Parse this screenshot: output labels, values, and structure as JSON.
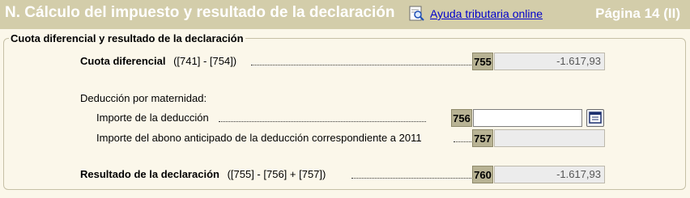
{
  "header": {
    "title": "N. Cálculo del impuesto y resultado de la declaración",
    "help_icon": "help-magnifier-icon",
    "help_link": "Ayuda tributaria online",
    "page": "Página 14 (II)"
  },
  "section": {
    "title": "Cuota diferencial y resultado de la declaración",
    "cuota": {
      "label": "Cuota diferencial",
      "formula": "([741] - [754])",
      "code": "755",
      "value": "-1.617,93"
    },
    "maternidad_heading": "Deducción por maternidad:",
    "importe": {
      "label": "Importe de la deducción",
      "code": "756",
      "value": "",
      "button_icon": "calculator-icon"
    },
    "abono": {
      "label": "Importe del abono anticipado de la deducción correspondiente a 2011",
      "code": "757",
      "value": ""
    },
    "resultado": {
      "label": "Resultado de la declaración",
      "formula": "([755] - [756] + [757])",
      "code": "760",
      "value": "-1.617,93"
    }
  }
}
